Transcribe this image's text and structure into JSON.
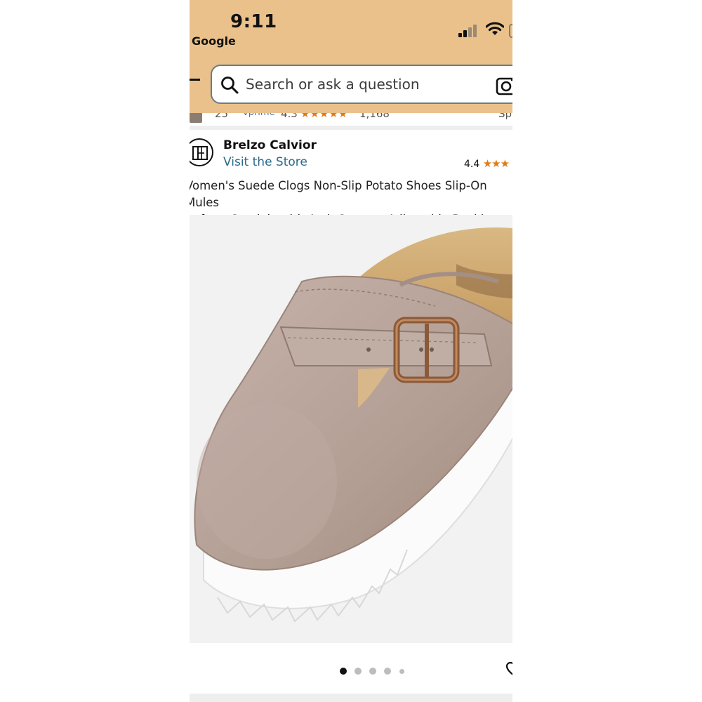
{
  "status_bar": {
    "time": "9:11",
    "back_app": "Google"
  },
  "search": {
    "placeholder": "Search or ask a question"
  },
  "previous_result": {
    "count": "25",
    "prime": "vprime",
    "rating": "4.3",
    "stars": "★★★★★",
    "reviews": "1,168",
    "trailing": "Sp"
  },
  "brand": {
    "name": "Brelzo Calvior",
    "visit_store": "Visit the Store",
    "rating": "4.4",
    "stars": "★★★"
  },
  "product": {
    "title": "Vomen's Suede Clogs Non-Slip Potato Shoes Slip-On Mules\nlatform Sandals with Arch Support Adjustable Buckle"
  },
  "carousel": {
    "total_images": 5,
    "active_index": 0
  },
  "colors": {
    "header_bg": "#eac18b",
    "link": "#2a6b8a",
    "star": "#e47911",
    "suede": "#b8a39a"
  }
}
